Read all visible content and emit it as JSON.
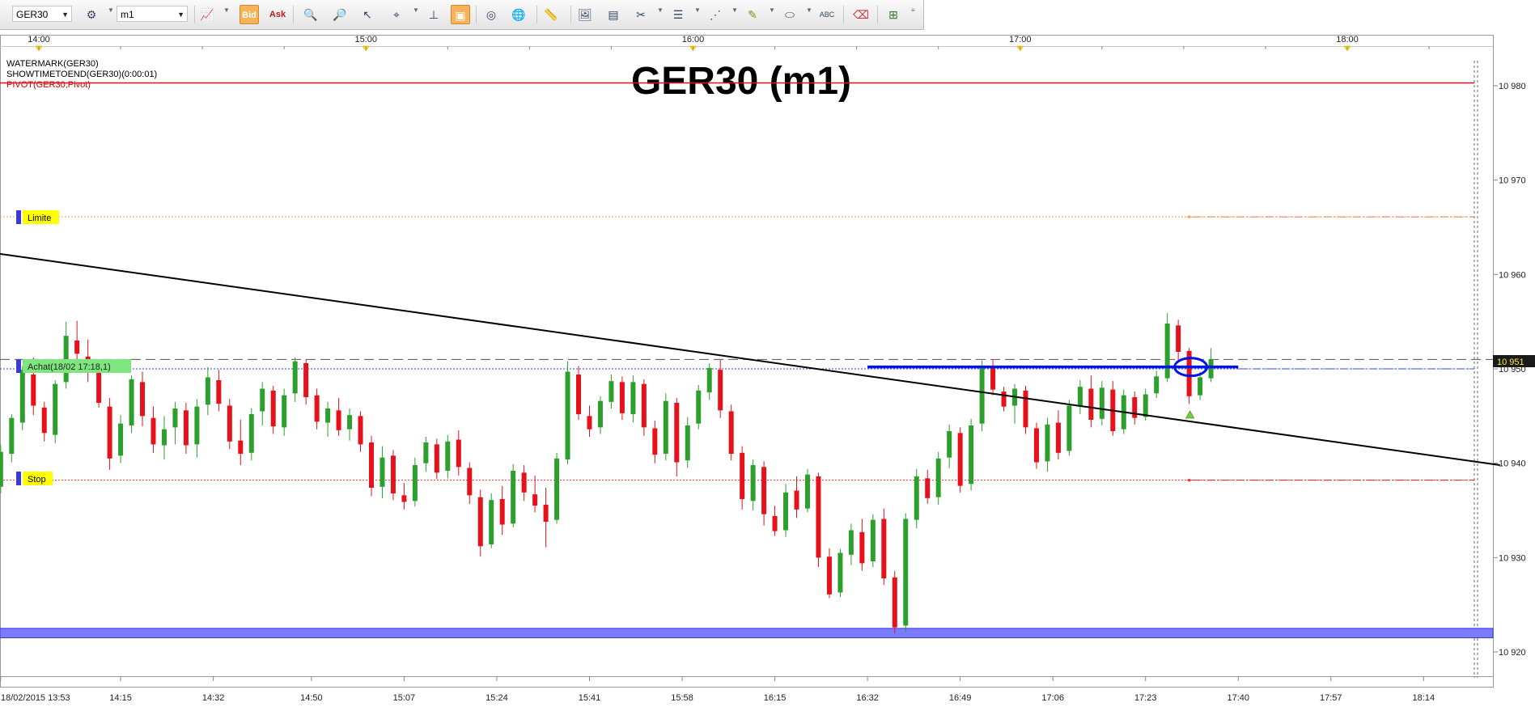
{
  "toolbar": {
    "symbol": "GER30",
    "timeframe": "m1",
    "bid_label": "Bid",
    "ask_label": "Ask"
  },
  "indicators": [
    "WATERMARK(GER30)",
    "SHOWTIMETOEND(GER30)(0:00:01)",
    "PIVOT(GER30,Pivot)"
  ],
  "watermark": "GER30 (m1)",
  "markers": {
    "limit_label": "Limite",
    "buy_label": "Achat(18/02 17:18,1)",
    "stop_label": "Stop"
  },
  "current_price_label": "10 951",
  "colors": {
    "bull": "#2ca02c",
    "bear": "#e8101a",
    "trendline": "#000000",
    "support_band": "#7b7bff",
    "resistance": "#e8101a",
    "breakout": "#0014e8"
  },
  "chart_data": {
    "type": "candlestick",
    "top_axis_labels": [
      "14:00",
      "15:00",
      "16:00",
      "17:00",
      "18:00"
    ],
    "x_tick_labels": [
      "18/02/2015 13:53",
      "14:15",
      "14:32",
      "14:50",
      "15:07",
      "15:24",
      "15:41",
      "15:58",
      "16:15",
      "16:32",
      "16:49",
      "17:06",
      "17:23",
      "17:40",
      "17:57",
      "18:14"
    ],
    "y_tick_labels": [
      "10 980",
      "10 970",
      "10 960",
      "10 950",
      "10 940",
      "10 930",
      "10 920"
    ],
    "ylim": [
      10918,
      10986
    ],
    "levels": {
      "resistance": 10980.3,
      "limit": 10966.1,
      "buy": 10950.0,
      "current": 10951.0,
      "stop": 10938.2,
      "support_band": [
        10921.5,
        10922.5
      ]
    },
    "trendline": {
      "start": [
        "13:53",
        10962.2
      ],
      "end": [
        "18:28",
        10939.8
      ]
    },
    "breakout_segment": {
      "x": [
        "16:32",
        "17:40"
      ],
      "y": 10950.2
    },
    "candles": [
      {
        "t": "13:53",
        "o": 10937.5,
        "h": 10942.0,
        "l": 10936.8,
        "c": 10941.2
      },
      {
        "t": "13:55",
        "o": 10941.0,
        "h": 10945.2,
        "l": 10940.1,
        "c": 10944.8
      },
      {
        "t": "13:57",
        "o": 10944.3,
        "h": 10950.3,
        "l": 10943.5,
        "c": 10949.9
      },
      {
        "t": "13:59",
        "o": 10949.4,
        "h": 10951.2,
        "l": 10945.1,
        "c": 10946.1
      },
      {
        "t": "14:01",
        "o": 10945.9,
        "h": 10946.5,
        "l": 10942.3,
        "c": 10943.2
      },
      {
        "t": "14:03",
        "o": 10943.0,
        "h": 10948.8,
        "l": 10942.1,
        "c": 10948.4
      },
      {
        "t": "14:05",
        "o": 10948.6,
        "h": 10955.0,
        "l": 10947.9,
        "c": 10953.5
      },
      {
        "t": "14:07",
        "o": 10953.0,
        "h": 10955.1,
        "l": 10950.2,
        "c": 10951.6
      },
      {
        "t": "14:09",
        "o": 10951.3,
        "h": 10953.1,
        "l": 10948.6,
        "c": 10949.7
      },
      {
        "t": "14:11",
        "o": 10949.8,
        "h": 10950.4,
        "l": 10945.9,
        "c": 10946.4
      },
      {
        "t": "14:13",
        "o": 10946.0,
        "h": 10946.9,
        "l": 10939.3,
        "c": 10940.5
      },
      {
        "t": "14:15",
        "o": 10940.8,
        "h": 10945.1,
        "l": 10940.0,
        "c": 10944.2
      },
      {
        "t": "14:17",
        "o": 10944.0,
        "h": 10949.3,
        "l": 10943.2,
        "c": 10948.9
      },
      {
        "t": "14:19",
        "o": 10948.6,
        "h": 10949.7,
        "l": 10943.9,
        "c": 10945.0
      },
      {
        "t": "14:21",
        "o": 10944.8,
        "h": 10946.0,
        "l": 10941.1,
        "c": 10942.0
      },
      {
        "t": "14:23",
        "o": 10941.9,
        "h": 10945.0,
        "l": 10940.4,
        "c": 10943.6
      },
      {
        "t": "14:25",
        "o": 10943.8,
        "h": 10946.5,
        "l": 10942.0,
        "c": 10945.8
      },
      {
        "t": "14:27",
        "o": 10945.6,
        "h": 10946.4,
        "l": 10941.0,
        "c": 10941.9
      },
      {
        "t": "14:29",
        "o": 10942.0,
        "h": 10946.8,
        "l": 10940.6,
        "c": 10946.0
      },
      {
        "t": "14:31",
        "o": 10946.2,
        "h": 10950.2,
        "l": 10945.1,
        "c": 10949.1
      },
      {
        "t": "14:33",
        "o": 10948.8,
        "h": 10949.9,
        "l": 10945.5,
        "c": 10946.3
      },
      {
        "t": "14:35",
        "o": 10946.1,
        "h": 10946.8,
        "l": 10941.5,
        "c": 10942.3
      },
      {
        "t": "14:37",
        "o": 10942.4,
        "h": 10944.6,
        "l": 10939.8,
        "c": 10941.0
      },
      {
        "t": "14:39",
        "o": 10941.1,
        "h": 10945.8,
        "l": 10940.3,
        "c": 10945.2
      },
      {
        "t": "14:41",
        "o": 10945.5,
        "h": 10948.6,
        "l": 10944.0,
        "c": 10947.9
      },
      {
        "t": "14:43",
        "o": 10947.7,
        "h": 10948.2,
        "l": 10943.1,
        "c": 10943.9
      },
      {
        "t": "14:45",
        "o": 10943.8,
        "h": 10947.9,
        "l": 10942.9,
        "c": 10947.2
      },
      {
        "t": "14:47",
        "o": 10947.4,
        "h": 10951.2,
        "l": 10946.5,
        "c": 10950.8
      },
      {
        "t": "14:49",
        "o": 10950.6,
        "h": 10951.0,
        "l": 10946.2,
        "c": 10947.0
      },
      {
        "t": "14:51",
        "o": 10947.2,
        "h": 10947.9,
        "l": 10943.6,
        "c": 10944.4
      },
      {
        "t": "14:53",
        "o": 10944.3,
        "h": 10946.5,
        "l": 10942.8,
        "c": 10945.8
      },
      {
        "t": "14:55",
        "o": 10945.6,
        "h": 10946.9,
        "l": 10942.9,
        "c": 10943.5
      },
      {
        "t": "14:57",
        "o": 10943.6,
        "h": 10945.8,
        "l": 10942.4,
        "c": 10945.1
      },
      {
        "t": "14:59",
        "o": 10945.0,
        "h": 10945.5,
        "l": 10941.2,
        "c": 10942.0
      },
      {
        "t": "15:01",
        "o": 10942.2,
        "h": 10942.9,
        "l": 10936.5,
        "c": 10937.4
      },
      {
        "t": "15:03",
        "o": 10937.5,
        "h": 10941.8,
        "l": 10936.3,
        "c": 10940.6
      },
      {
        "t": "15:05",
        "o": 10940.8,
        "h": 10941.4,
        "l": 10936.1,
        "c": 10936.8
      },
      {
        "t": "15:07",
        "o": 10936.6,
        "h": 10937.9,
        "l": 10935.1,
        "c": 10935.9
      },
      {
        "t": "15:09",
        "o": 10936.0,
        "h": 10940.6,
        "l": 10935.4,
        "c": 10939.8
      },
      {
        "t": "15:11",
        "o": 10940.0,
        "h": 10942.8,
        "l": 10939.1,
        "c": 10942.2
      },
      {
        "t": "15:13",
        "o": 10942.0,
        "h": 10942.6,
        "l": 10938.3,
        "c": 10939.0
      },
      {
        "t": "15:15",
        "o": 10939.2,
        "h": 10943.0,
        "l": 10938.4,
        "c": 10942.3
      },
      {
        "t": "15:17",
        "o": 10942.5,
        "h": 10943.5,
        "l": 10938.7,
        "c": 10939.6
      },
      {
        "t": "15:19",
        "o": 10939.5,
        "h": 10940.1,
        "l": 10935.7,
        "c": 10936.6
      },
      {
        "t": "15:21",
        "o": 10936.4,
        "h": 10937.2,
        "l": 10930.1,
        "c": 10931.2
      },
      {
        "t": "15:23",
        "o": 10931.4,
        "h": 10936.8,
        "l": 10931.0,
        "c": 10936.1
      },
      {
        "t": "15:25",
        "o": 10936.2,
        "h": 10937.6,
        "l": 10932.4,
        "c": 10933.5
      },
      {
        "t": "15:27",
        "o": 10933.6,
        "h": 10939.9,
        "l": 10933.2,
        "c": 10939.2
      },
      {
        "t": "15:29",
        "o": 10939.0,
        "h": 10939.8,
        "l": 10936.0,
        "c": 10936.9
      },
      {
        "t": "15:31",
        "o": 10936.7,
        "h": 10938.7,
        "l": 10934.8,
        "c": 10935.5
      },
      {
        "t": "15:33",
        "o": 10935.6,
        "h": 10937.4,
        "l": 10931.1,
        "c": 10933.8
      },
      {
        "t": "15:35",
        "o": 10934.0,
        "h": 10941.1,
        "l": 10933.6,
        "c": 10940.5
      },
      {
        "t": "15:37",
        "o": 10940.4,
        "h": 10950.8,
        "l": 10939.9,
        "c": 10949.7
      },
      {
        "t": "15:39",
        "o": 10949.4,
        "h": 10950.3,
        "l": 10944.6,
        "c": 10945.2
      },
      {
        "t": "15:41",
        "o": 10945.0,
        "h": 10946.1,
        "l": 10942.8,
        "c": 10943.6
      },
      {
        "t": "15:43",
        "o": 10943.8,
        "h": 10947.1,
        "l": 10943.1,
        "c": 10946.6
      },
      {
        "t": "15:45",
        "o": 10946.5,
        "h": 10949.4,
        "l": 10945.8,
        "c": 10948.7
      },
      {
        "t": "15:47",
        "o": 10948.6,
        "h": 10949.2,
        "l": 10944.6,
        "c": 10945.3
      },
      {
        "t": "15:49",
        "o": 10945.2,
        "h": 10949.3,
        "l": 10944.3,
        "c": 10948.6
      },
      {
        "t": "15:51",
        "o": 10948.4,
        "h": 10948.9,
        "l": 10942.9,
        "c": 10943.8
      },
      {
        "t": "15:53",
        "o": 10943.7,
        "h": 10944.5,
        "l": 10940.0,
        "c": 10940.9
      },
      {
        "t": "15:55",
        "o": 10941.0,
        "h": 10947.4,
        "l": 10940.3,
        "c": 10946.6
      },
      {
        "t": "15:57",
        "o": 10946.4,
        "h": 10946.9,
        "l": 10938.6,
        "c": 10940.1
      },
      {
        "t": "15:59",
        "o": 10940.3,
        "h": 10944.9,
        "l": 10939.5,
        "c": 10944.0
      },
      {
        "t": "16:01",
        "o": 10944.2,
        "h": 10948.3,
        "l": 10943.6,
        "c": 10947.7
      },
      {
        "t": "16:03",
        "o": 10947.5,
        "h": 10950.6,
        "l": 10946.7,
        "c": 10950.1
      },
      {
        "t": "16:05",
        "o": 10949.9,
        "h": 10951.0,
        "l": 10944.8,
        "c": 10945.6
      },
      {
        "t": "16:07",
        "o": 10945.5,
        "h": 10946.2,
        "l": 10940.3,
        "c": 10941.0
      },
      {
        "t": "16:09",
        "o": 10941.1,
        "h": 10941.8,
        "l": 10935.1,
        "c": 10936.2
      },
      {
        "t": "16:11",
        "o": 10936.0,
        "h": 10940.4,
        "l": 10935.0,
        "c": 10939.8
      },
      {
        "t": "16:13",
        "o": 10939.6,
        "h": 10940.2,
        "l": 10933.4,
        "c": 10934.6
      },
      {
        "t": "16:15",
        "o": 10934.4,
        "h": 10935.5,
        "l": 10932.3,
        "c": 10932.8
      },
      {
        "t": "16:17",
        "o": 10932.9,
        "h": 10937.8,
        "l": 10932.2,
        "c": 10936.9
      },
      {
        "t": "16:19",
        "o": 10937.1,
        "h": 10938.6,
        "l": 10934.2,
        "c": 10935.1
      },
      {
        "t": "16:21",
        "o": 10935.2,
        "h": 10939.4,
        "l": 10934.8,
        "c": 10938.8
      },
      {
        "t": "16:23",
        "o": 10938.6,
        "h": 10939.0,
        "l": 10929.0,
        "c": 10930.0
      },
      {
        "t": "16:25",
        "o": 10930.1,
        "h": 10931.0,
        "l": 10925.7,
        "c": 10926.1
      },
      {
        "t": "16:27",
        "o": 10926.3,
        "h": 10930.9,
        "l": 10925.8,
        "c": 10930.5
      },
      {
        "t": "16:29",
        "o": 10930.3,
        "h": 10933.6,
        "l": 10929.2,
        "c": 10932.9
      },
      {
        "t": "16:31",
        "o": 10932.7,
        "h": 10934.1,
        "l": 10928.6,
        "c": 10929.4
      },
      {
        "t": "16:33",
        "o": 10929.6,
        "h": 10934.6,
        "l": 10929.0,
        "c": 10934.0
      },
      {
        "t": "16:35",
        "o": 10934.1,
        "h": 10935.2,
        "l": 10927.1,
        "c": 10927.8
      },
      {
        "t": "16:37",
        "o": 10927.9,
        "h": 10928.6,
        "l": 10922.0,
        "c": 10922.6
      },
      {
        "t": "16:39",
        "o": 10922.8,
        "h": 10934.7,
        "l": 10922.1,
        "c": 10934.1
      },
      {
        "t": "16:41",
        "o": 10934.0,
        "h": 10939.4,
        "l": 10933.1,
        "c": 10938.6
      },
      {
        "t": "16:43",
        "o": 10938.4,
        "h": 10939.3,
        "l": 10935.7,
        "c": 10936.3
      },
      {
        "t": "16:45",
        "o": 10936.4,
        "h": 10941.2,
        "l": 10935.6,
        "c": 10940.5
      },
      {
        "t": "16:47",
        "o": 10940.6,
        "h": 10944.1,
        "l": 10939.5,
        "c": 10943.4
      },
      {
        "t": "16:49",
        "o": 10943.2,
        "h": 10943.8,
        "l": 10936.9,
        "c": 10937.6
      },
      {
        "t": "16:51",
        "o": 10937.8,
        "h": 10944.7,
        "l": 10937.1,
        "c": 10944.0
      },
      {
        "t": "16:53",
        "o": 10944.2,
        "h": 10950.9,
        "l": 10943.4,
        "c": 10950.3
      },
      {
        "t": "16:55",
        "o": 10950.1,
        "h": 10951.0,
        "l": 10947.2,
        "c": 10947.8
      },
      {
        "t": "16:57",
        "o": 10947.6,
        "h": 10948.1,
        "l": 10945.5,
        "c": 10946.0
      },
      {
        "t": "16:59",
        "o": 10946.1,
        "h": 10948.4,
        "l": 10944.2,
        "c": 10947.9
      },
      {
        "t": "17:01",
        "o": 10947.7,
        "h": 10948.2,
        "l": 10943.1,
        "c": 10943.8
      },
      {
        "t": "17:03",
        "o": 10943.7,
        "h": 10944.3,
        "l": 10939.4,
        "c": 10940.1
      },
      {
        "t": "17:05",
        "o": 10940.2,
        "h": 10944.8,
        "l": 10939.1,
        "c": 10944.1
      },
      {
        "t": "17:07",
        "o": 10944.3,
        "h": 10945.6,
        "l": 10940.4,
        "c": 10941.1
      },
      {
        "t": "17:09",
        "o": 10941.3,
        "h": 10946.7,
        "l": 10940.8,
        "c": 10946.1
      },
      {
        "t": "17:11",
        "o": 10946.0,
        "h": 10948.8,
        "l": 10945.2,
        "c": 10948.1
      },
      {
        "t": "17:13",
        "o": 10947.9,
        "h": 10949.3,
        "l": 10943.8,
        "c": 10944.6
      },
      {
        "t": "17:15",
        "o": 10944.7,
        "h": 10948.7,
        "l": 10944.0,
        "c": 10948.0
      },
      {
        "t": "17:17",
        "o": 10947.8,
        "h": 10948.7,
        "l": 10942.9,
        "c": 10943.4
      },
      {
        "t": "17:19",
        "o": 10943.6,
        "h": 10947.8,
        "l": 10943.1,
        "c": 10947.2
      },
      {
        "t": "17:21",
        "o": 10947.0,
        "h": 10947.6,
        "l": 10944.1,
        "c": 10944.8
      },
      {
        "t": "17:23",
        "o": 10944.9,
        "h": 10947.9,
        "l": 10944.5,
        "c": 10947.3
      },
      {
        "t": "17:25",
        "o": 10947.4,
        "h": 10949.8,
        "l": 10946.9,
        "c": 10949.2
      },
      {
        "t": "17:27",
        "o": 10949.0,
        "h": 10955.9,
        "l": 10948.6,
        "c": 10954.8
      },
      {
        "t": "17:29",
        "o": 10954.6,
        "h": 10955.2,
        "l": 10950.9,
        "c": 10951.8
      },
      {
        "t": "17:31",
        "o": 10951.9,
        "h": 10952.2,
        "l": 10946.3,
        "c": 10947.1
      },
      {
        "t": "17:33",
        "o": 10947.2,
        "h": 10949.7,
        "l": 10946.7,
        "c": 10949.1
      },
      {
        "t": "17:35",
        "o": 10949.0,
        "h": 10952.2,
        "l": 10948.6,
        "c": 10951.0
      }
    ]
  }
}
